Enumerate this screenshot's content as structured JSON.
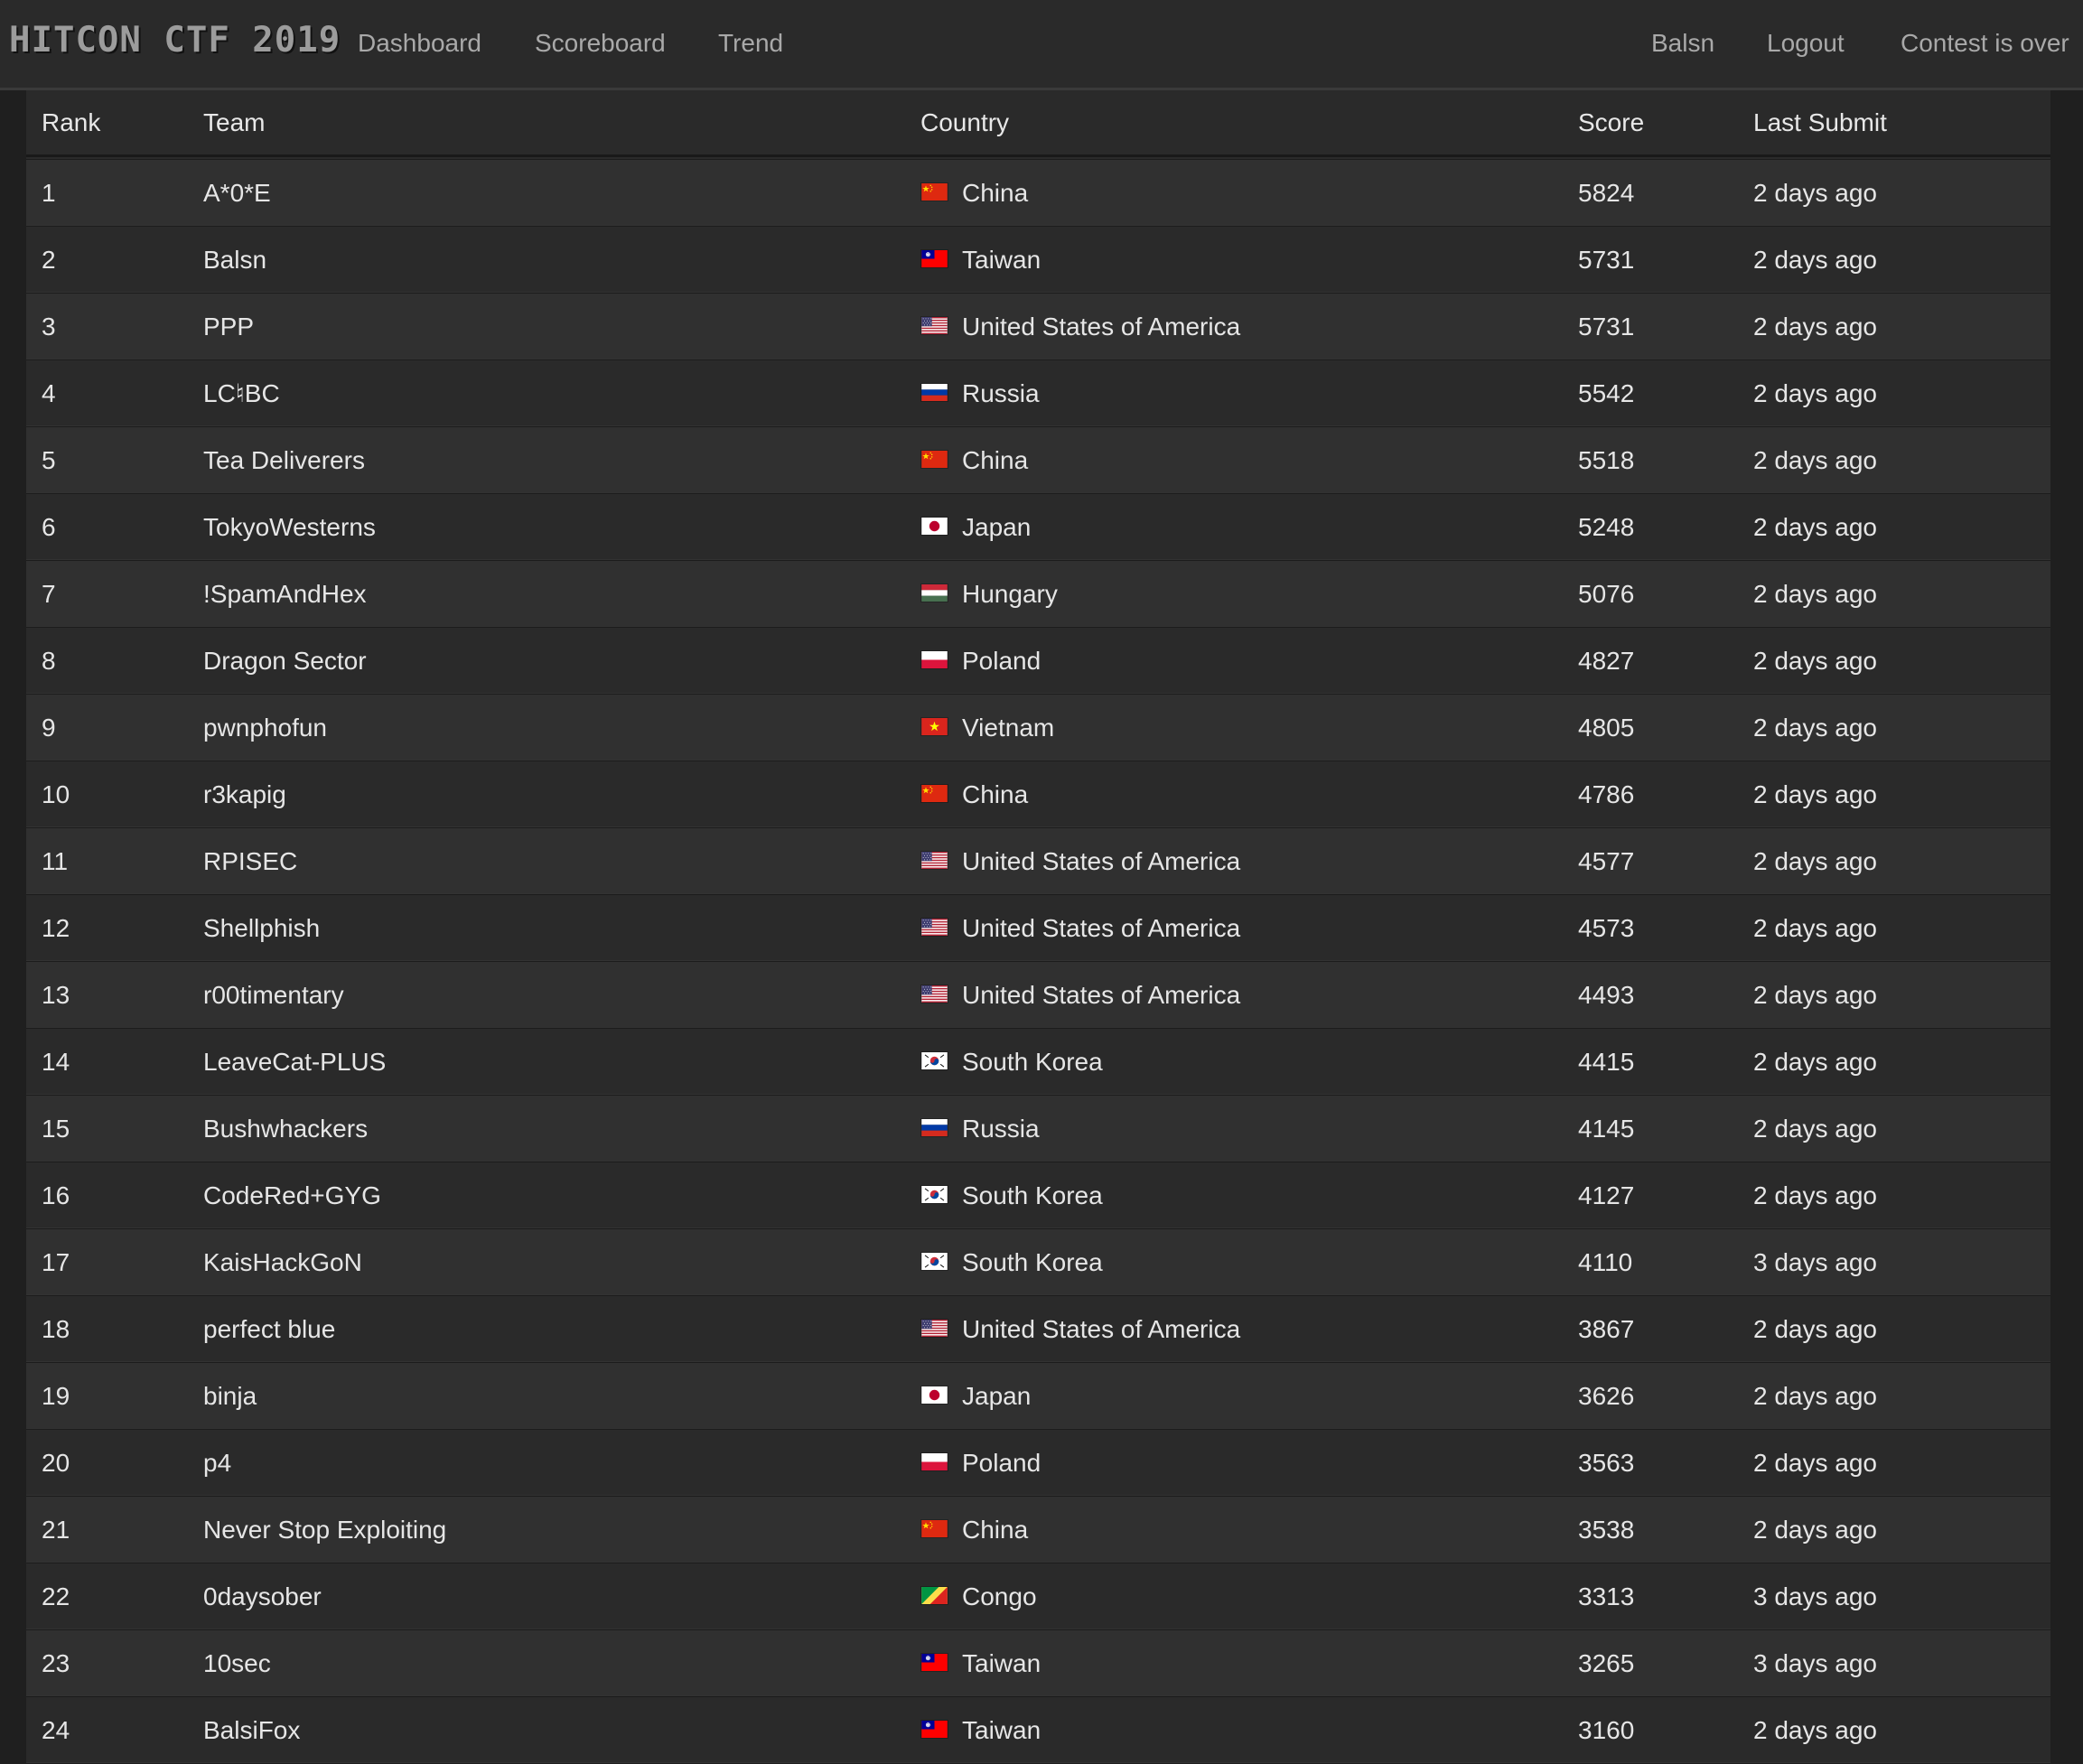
{
  "app": {
    "brand": "HITCON CTF 2019",
    "nav": [
      "Dashboard",
      "Scoreboard",
      "Trend"
    ],
    "right_nav": [
      "Balsn",
      "Logout",
      "Contest is over"
    ]
  },
  "table": {
    "headers": [
      "Rank",
      "Team",
      "Country",
      "Score",
      "Last Submit"
    ],
    "rows": [
      {
        "rank": "1",
        "team": "A*0*E",
        "country": "China",
        "flag": "china-flag-icon",
        "score": "5824",
        "last": "2 days ago"
      },
      {
        "rank": "2",
        "team": "Balsn",
        "country": "Taiwan",
        "flag": "taiwan-flag-icon",
        "score": "5731",
        "last": "2 days ago"
      },
      {
        "rank": "3",
        "team": "PPP",
        "country": "United States of America",
        "flag": "usa-flag-icon",
        "score": "5731",
        "last": "2 days ago"
      },
      {
        "rank": "4",
        "team": "LC♮BC",
        "country": "Russia",
        "flag": "russia-flag-icon",
        "score": "5542",
        "last": "2 days ago"
      },
      {
        "rank": "5",
        "team": "Tea Deliverers",
        "country": "China",
        "flag": "china-flag-icon",
        "score": "5518",
        "last": "2 days ago"
      },
      {
        "rank": "6",
        "team": "TokyoWesterns",
        "country": "Japan",
        "flag": "japan-flag-icon",
        "score": "5248",
        "last": "2 days ago"
      },
      {
        "rank": "7",
        "team": "!SpamAndHex",
        "country": "Hungary",
        "flag": "hungary-flag-icon",
        "score": "5076",
        "last": "2 days ago"
      },
      {
        "rank": "8",
        "team": "Dragon Sector",
        "country": "Poland",
        "flag": "poland-flag-icon",
        "score": "4827",
        "last": "2 days ago"
      },
      {
        "rank": "9",
        "team": "pwnphofun",
        "country": "Vietnam",
        "flag": "vietnam-flag-icon",
        "score": "4805",
        "last": "2 days ago"
      },
      {
        "rank": "10",
        "team": "r3kapig",
        "country": "China",
        "flag": "china-flag-icon",
        "score": "4786",
        "last": "2 days ago"
      },
      {
        "rank": "11",
        "team": "RPISEC",
        "country": "United States of America",
        "flag": "usa-flag-icon",
        "score": "4577",
        "last": "2 days ago"
      },
      {
        "rank": "12",
        "team": "Shellphish",
        "country": "United States of America",
        "flag": "usa-flag-icon",
        "score": "4573",
        "last": "2 days ago"
      },
      {
        "rank": "13",
        "team": "r00timentary",
        "country": "United States of America",
        "flag": "usa-flag-icon",
        "score": "4493",
        "last": "2 days ago"
      },
      {
        "rank": "14",
        "team": "LeaveCat-PLUS",
        "country": "South Korea",
        "flag": "south-korea-flag-icon",
        "score": "4415",
        "last": "2 days ago"
      },
      {
        "rank": "15",
        "team": "Bushwhackers",
        "country": "Russia",
        "flag": "russia-flag-icon",
        "score": "4145",
        "last": "2 days ago"
      },
      {
        "rank": "16",
        "team": "CodeRed+GYG",
        "country": "South Korea",
        "flag": "south-korea-flag-icon",
        "score": "4127",
        "last": "2 days ago"
      },
      {
        "rank": "17",
        "team": "KaisHackGoN",
        "country": "South Korea",
        "flag": "south-korea-flag-icon",
        "score": "4110",
        "last": "3 days ago"
      },
      {
        "rank": "18",
        "team": "perfect blue",
        "country": "United States of America",
        "flag": "usa-flag-icon",
        "score": "3867",
        "last": "2 days ago"
      },
      {
        "rank": "19",
        "team": "binja",
        "country": "Japan",
        "flag": "japan-flag-icon",
        "score": "3626",
        "last": "2 days ago"
      },
      {
        "rank": "20",
        "team": "p4",
        "country": "Poland",
        "flag": "poland-flag-icon",
        "score": "3563",
        "last": "2 days ago"
      },
      {
        "rank": "21",
        "team": "Never Stop Exploiting",
        "country": "China",
        "flag": "china-flag-icon",
        "score": "3538",
        "last": "2 days ago"
      },
      {
        "rank": "22",
        "team": "0daysober",
        "country": "Congo",
        "flag": "congo-flag-icon",
        "score": "3313",
        "last": "3 days ago"
      },
      {
        "rank": "23",
        "team": "10sec",
        "country": "Taiwan",
        "flag": "taiwan-flag-icon",
        "score": "3265",
        "last": "3 days ago"
      },
      {
        "rank": "24",
        "team": "BalsiFox",
        "country": "Taiwan",
        "flag": "taiwan-flag-icon",
        "score": "3160",
        "last": "2 days ago"
      }
    ]
  }
}
